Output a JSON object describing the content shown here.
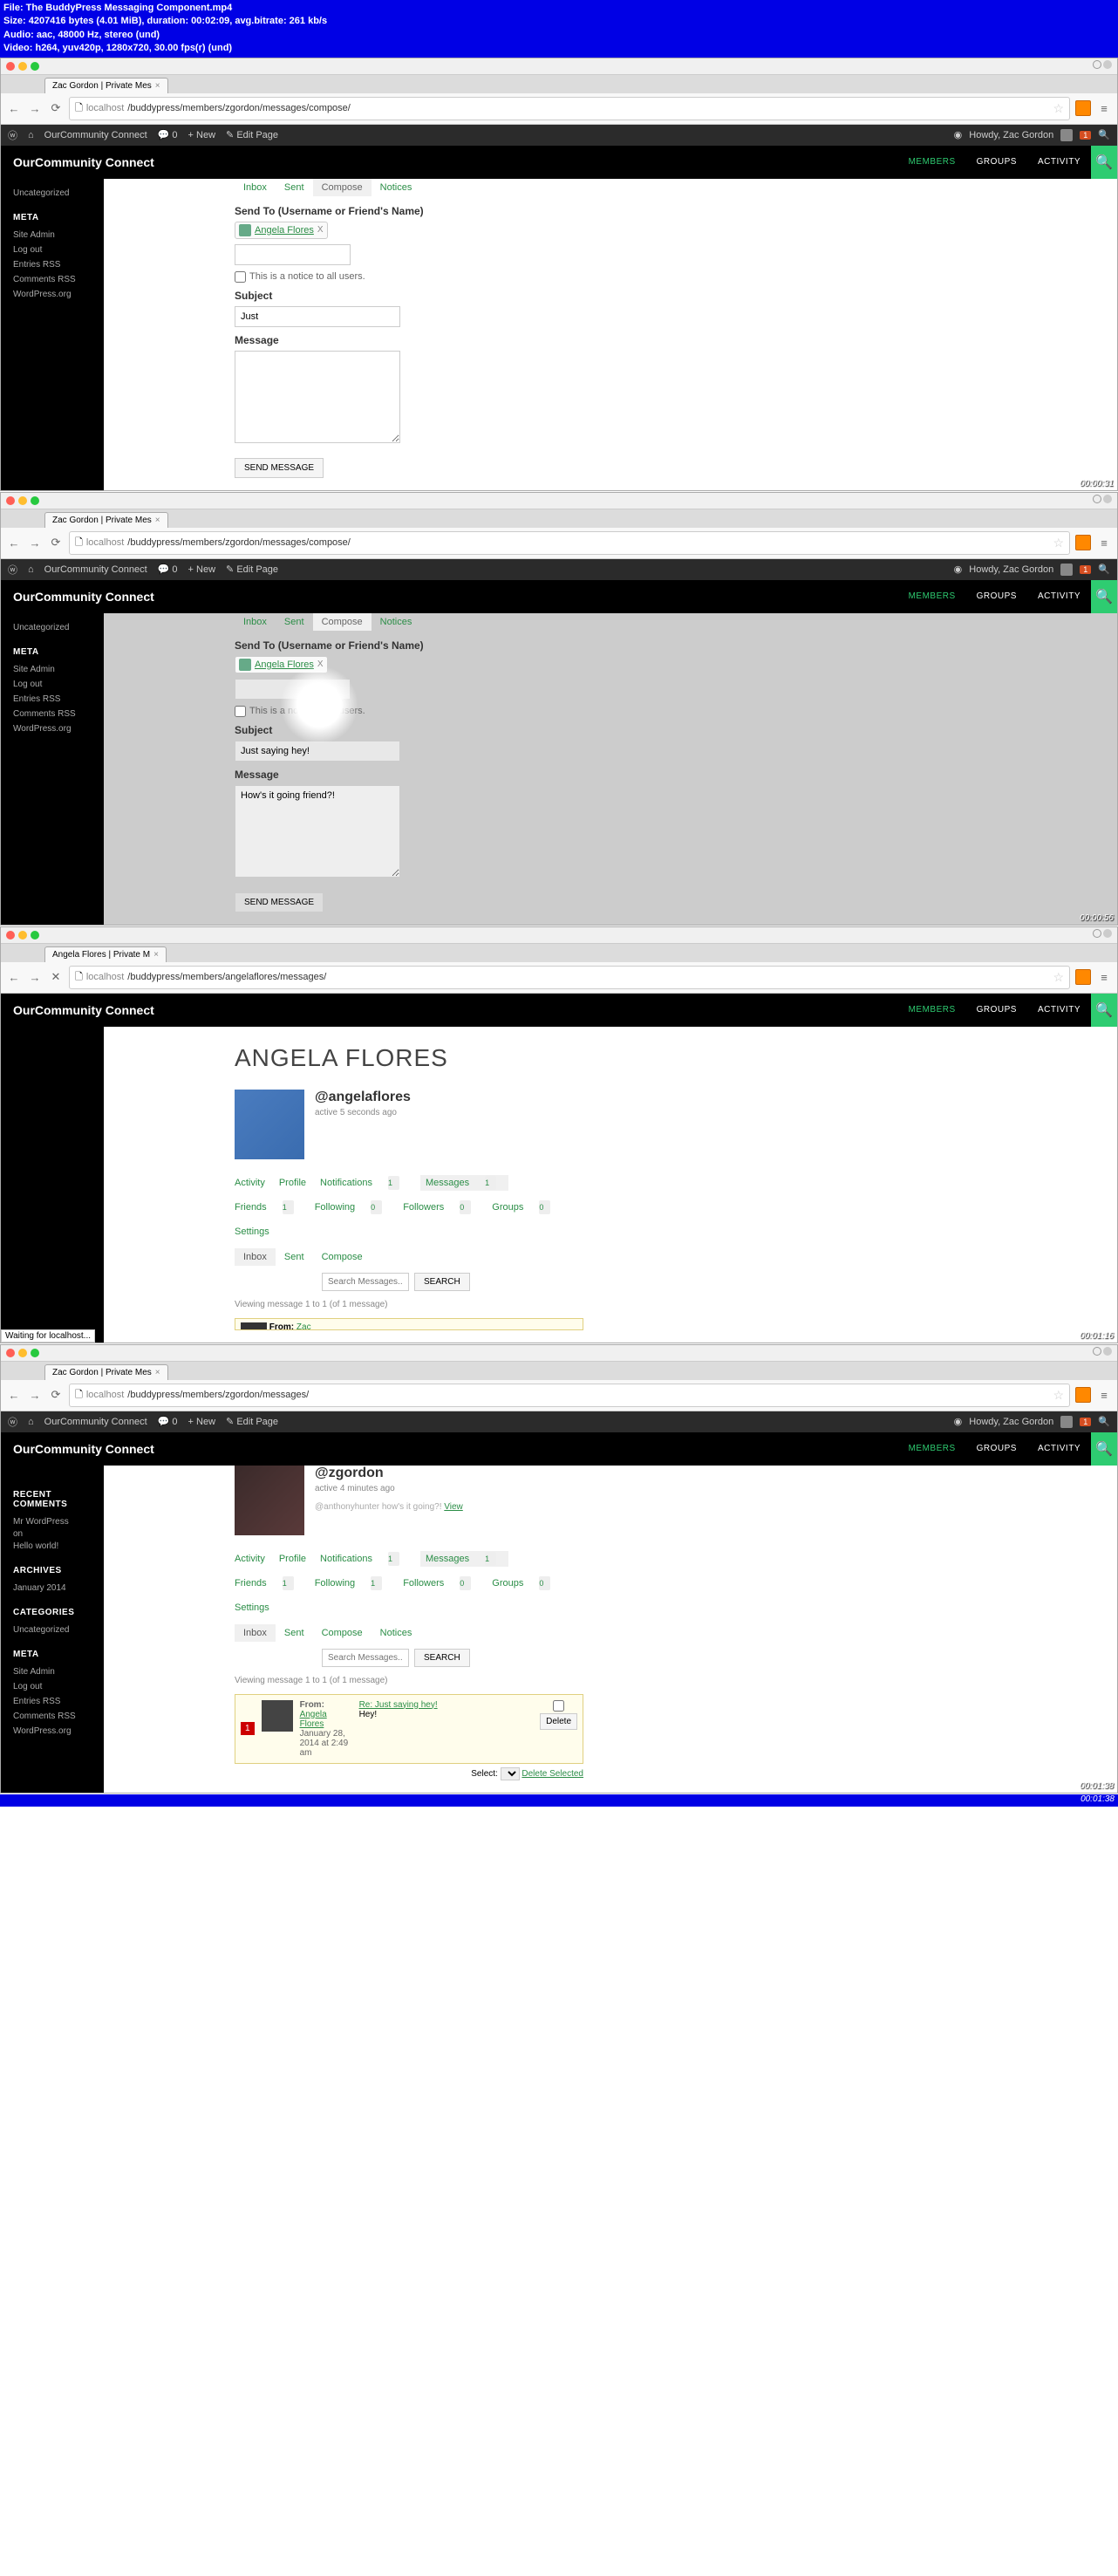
{
  "video": {
    "file": "File: The BuddyPress Messaging Component.mp4",
    "size": "Size: 4207416 bytes (4.01 MiB), duration: 00:02:09, avg.bitrate: 261 kb/s",
    "audio": "Audio: aac, 48000 Hz, stereo (und)",
    "video_line": "Video: h264, yuv420p, 1280x720, 30.00 fps(r) (und)"
  },
  "f1": {
    "tab": "Zac Gordon | Private Mes",
    "url_grey1": "localhost",
    "url_dark": "/buddypress/members/zgordon/messages/compose/",
    "wp_site": "OurCommunity Connect",
    "wp_comments": "0",
    "wp_new": "New",
    "wp_edit": "Edit Page",
    "wp_howdy": "Howdy, Zac Gordon",
    "site_title": "OurCommunity Connect",
    "nav": {
      "members": "MEMBERS",
      "groups": "GROUPS",
      "activity": "ACTIVITY"
    },
    "side": {
      "uncat": "Uncategorized",
      "meta": "META",
      "admin": "Site Admin",
      "logout": "Log out",
      "entries": "Entries RSS",
      "comments": "Comments RSS",
      "wp": "WordPress.org"
    },
    "tabs": {
      "inbox": "Inbox",
      "sent": "Sent",
      "compose": "Compose",
      "notices": "Notices"
    },
    "sendto": "Send To (Username or Friend's Name)",
    "recipient": "Angela Flores",
    "notice": "This is a notice to all users.",
    "subject": "Subject",
    "subject_val": "Just",
    "message": "Message",
    "send": "SEND MESSAGE",
    "ts": "00:00:31"
  },
  "f2": {
    "subject_val": "Just saying hey!",
    "message_val": "How's it going friend?!",
    "ts": "00:00:56"
  },
  "f3": {
    "tab": "Angela Flores | Private M",
    "url_dark": "/buddypress/members/angelaflores/messages/",
    "title": "ANGELA FLORES",
    "username": "@angelaflores",
    "active": "active 5 seconds ago",
    "nav": {
      "activity": "Activity",
      "profile": "Profile",
      "notif": "Notifications",
      "notif_b": "1",
      "msg": "Messages",
      "msg_b": "1",
      "friends": "Friends",
      "friends_b": "1",
      "following": "Following",
      "following_b": "0",
      "followers": "Followers",
      "followers_b": "0",
      "groups": "Groups",
      "groups_b": "0",
      "settings": "Settings"
    },
    "sub": {
      "inbox": "Inbox",
      "sent": "Sent",
      "compose": "Compose"
    },
    "search_ph": "Search Messages...",
    "search_btn": "SEARCH",
    "pag": "Viewing message 1 to 1 (of 1 message)",
    "from": "From:",
    "from_name": "Zac",
    "waiting": "Waiting for localhost...",
    "ts": "00:01:16"
  },
  "f4": {
    "tab": "Zac Gordon | Private Mes",
    "url_dark": "/buddypress/members/zgordon/messages/",
    "username": "@zgordon",
    "active": "active 4 minutes ago",
    "mention": "@anthonyhunter how's it going?!",
    "view": "View",
    "side_extra": {
      "recent": "RECENT COMMENTS",
      "comment1a": "Mr WordPress",
      "comment1b": " on ",
      "comment1c": "Hello world!",
      "archives": "ARCHIVES",
      "jan": "January 2014",
      "cat": "CATEGORIES"
    },
    "nav": {
      "activity": "Activity",
      "profile": "Profile",
      "notif": "Notifications",
      "notif_b": "1",
      "msg": "Messages",
      "msg_b": "1",
      "friends": "Friends",
      "friends_b": "1",
      "following": "Following",
      "following_b": "1",
      "followers": "Followers",
      "followers_b": "0",
      "groups": "Groups",
      "groups_b": "0",
      "settings": "Settings"
    },
    "sub": {
      "inbox": "Inbox",
      "sent": "Sent",
      "compose": "Compose",
      "notices": "Notices"
    },
    "pag": "Viewing message 1 to 1 (of 1 message)",
    "msg": {
      "badge": "1",
      "from": "From:",
      "from_name": "Angela Flores",
      "date": "January 28, 2014 at 2:49 am",
      "subject": "Re: Just saying hey!",
      "excerpt": "Hey!",
      "delete": "Delete"
    },
    "select": "Select:",
    "del_sel": "Delete Selected",
    "ts": "00:01:38",
    "bottom_ts": "00:01:38"
  }
}
